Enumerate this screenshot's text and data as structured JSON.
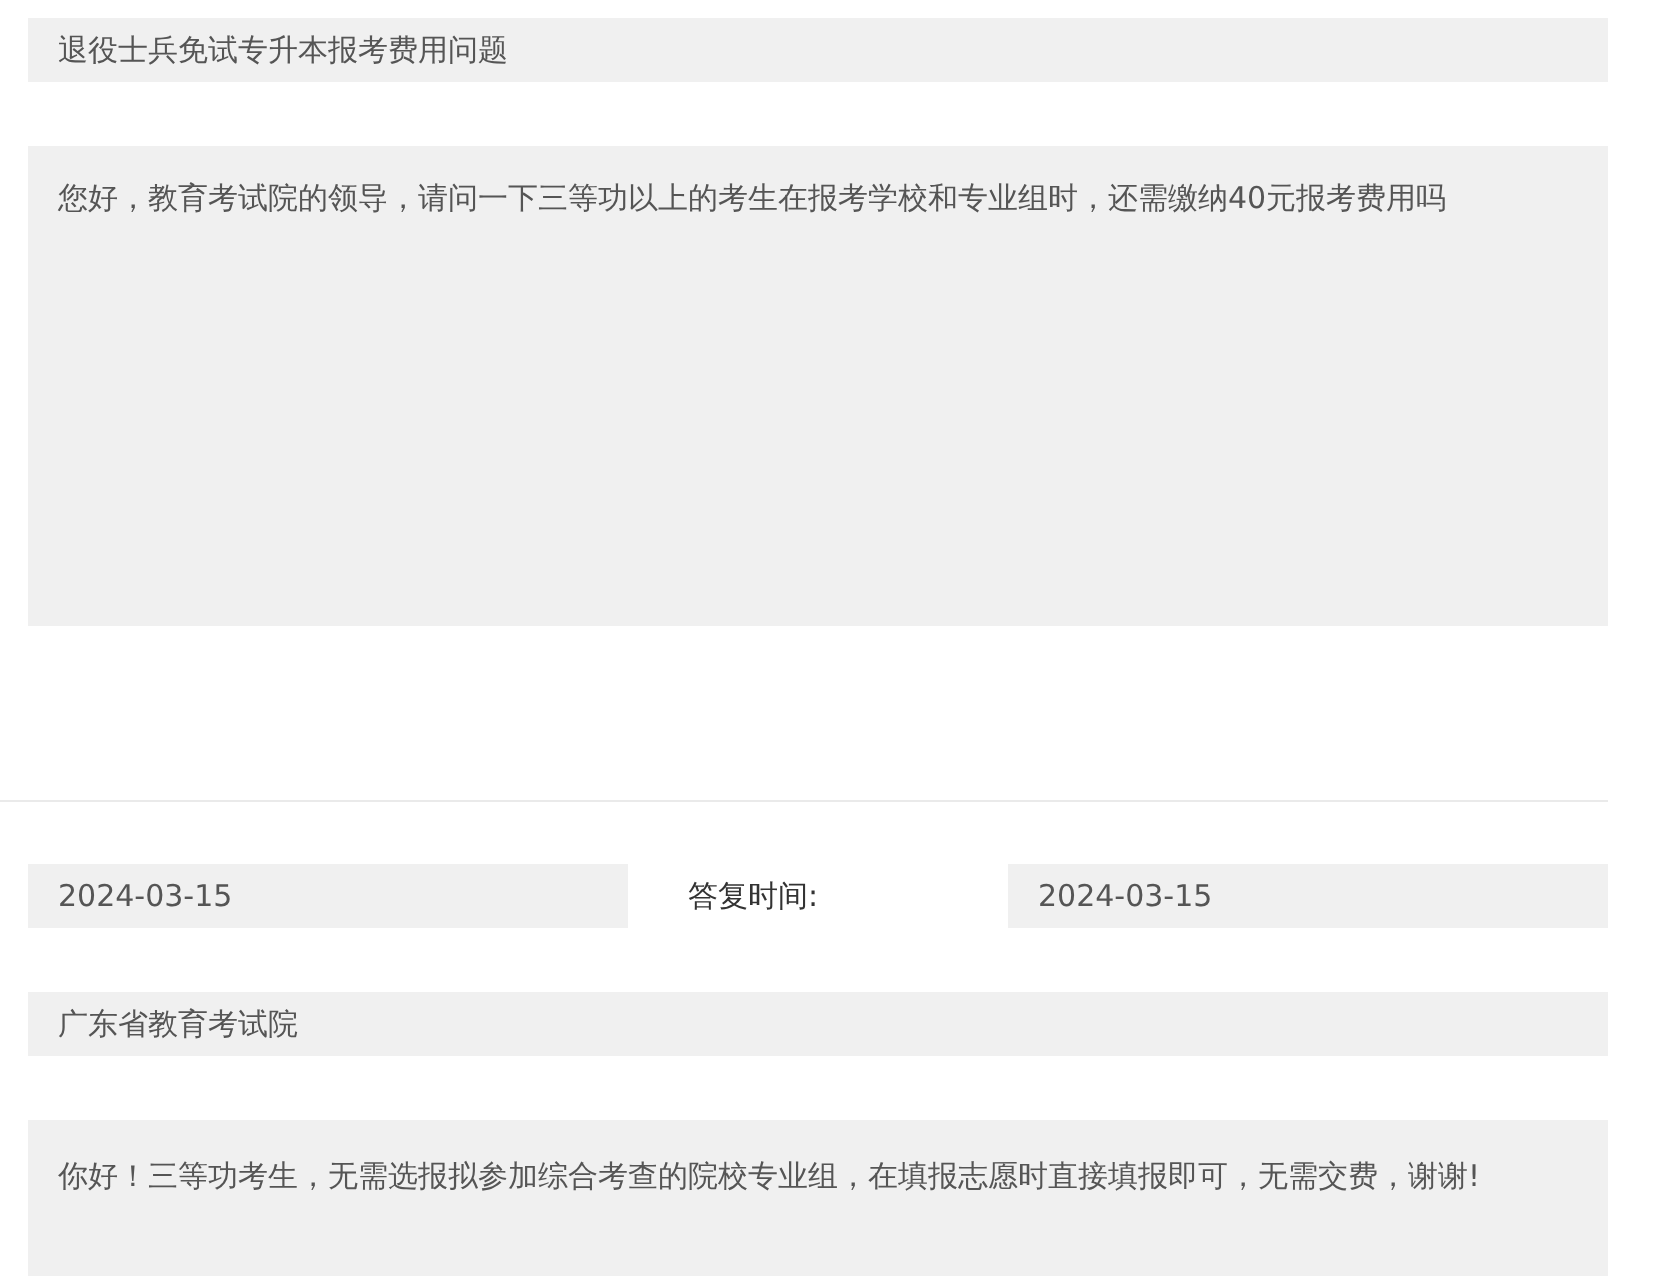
{
  "title": "退役士兵免试专升本报考费用问题",
  "question": "您好，教育考试院的领导，请问一下三等功以上的考生在报考学校和专业组时，还需缴纳40元报考费用吗",
  "ask_date": "2024-03-15",
  "reply_time_label": "答复时间:",
  "reply_date": "2024-03-15",
  "department": "广东省教育考试院",
  "answer": "你好！三等功考生，无需选报拟参加综合考查的院校专业组，在填报志愿时直接填报即可，无需交费，谢谢!"
}
